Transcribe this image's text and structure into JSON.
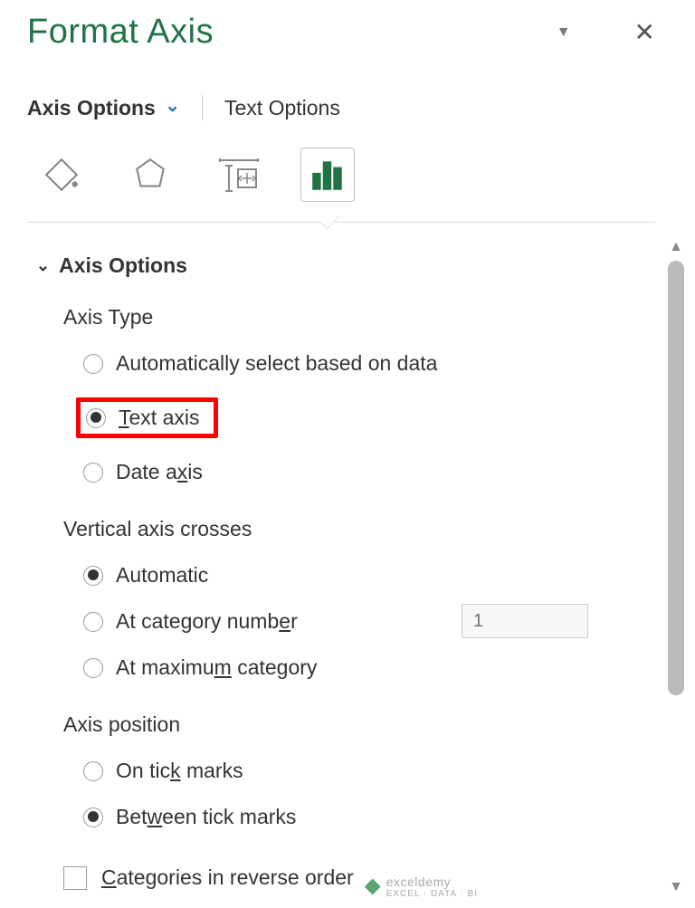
{
  "header": {
    "title": "Format Axis"
  },
  "tabs": {
    "axis_options": "Axis Options",
    "text_options": "Text Options"
  },
  "section": {
    "title": "Axis Options",
    "axis_type_label": "Axis Type",
    "axis_type": {
      "auto": "Automatically select based on data",
      "text_prefix": "T",
      "text_rest": "ext axis",
      "date_prefix": "Date a",
      "date_key": "x",
      "date_suffix": "is"
    },
    "vertical_label": "Vertical axis crosses",
    "vertical": {
      "automatic": "Automatic",
      "at_category_number_pre": "At category numb",
      "at_category_number_key": "e",
      "at_category_number_post": "r",
      "at_category_value": "1",
      "at_max_pre": "At maximu",
      "at_max_key": "m",
      "at_max_post": " category"
    },
    "axis_position_label": "Axis position",
    "axis_position": {
      "on_tick_pre": "On tic",
      "on_tick_key": "k",
      "on_tick_post": " marks",
      "between_pre": "Bet",
      "between_key": "w",
      "between_post": "een tick marks"
    },
    "reverse_pre": "C",
    "reverse_rest": "ategories in reverse order"
  },
  "watermark": {
    "brand": "exceldemy",
    "sub": "EXCEL · DATA · BI"
  }
}
